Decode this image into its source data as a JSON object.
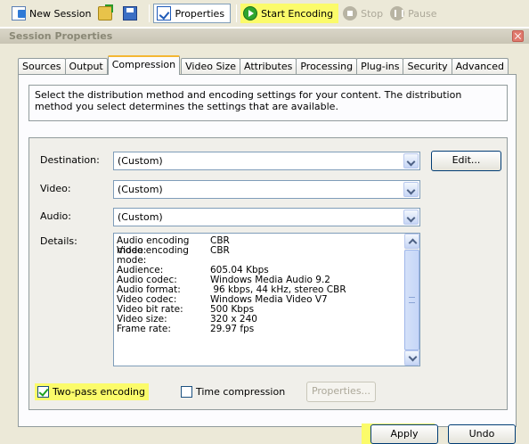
{
  "toolbar": {
    "new_session": "New Session",
    "properties": "Properties",
    "start_encoding": "Start Encoding",
    "stop": "Stop",
    "pause": "Pause"
  },
  "window": {
    "title": "Session Properties"
  },
  "tabs": [
    {
      "label": "Sources"
    },
    {
      "label": "Output"
    },
    {
      "label": "Compression",
      "active": true
    },
    {
      "label": "Video Size"
    },
    {
      "label": "Attributes"
    },
    {
      "label": "Processing"
    },
    {
      "label": "Plug-ins"
    },
    {
      "label": "Security"
    },
    {
      "label": "Advanced"
    }
  ],
  "intro_text": "Select the distribution method and encoding settings for your content. The distribution method you select determines the settings that are available.",
  "form": {
    "destination": {
      "label": "Destination:",
      "value": "(Custom)"
    },
    "video": {
      "label": "Video:",
      "value": "(Custom)"
    },
    "audio": {
      "label": "Audio:",
      "value": "(Custom)"
    },
    "edit_button": "Edit...",
    "details_label": "Details:"
  },
  "details": [
    {
      "k": "Audio encoding mode:",
      "v": "CBR"
    },
    {
      "k": "Video encoding mode:",
      "v": "CBR"
    },
    {
      "k": "",
      "v": ""
    },
    {
      "k": "Audience:",
      "v": "605.04 Kbps"
    },
    {
      "k": "Audio codec:",
      "v": "Windows Media Audio 9.2"
    },
    {
      "k": "Audio format:",
      "v": " 96 kbps, 44 kHz, stereo CBR"
    },
    {
      "k": "Video codec:",
      "v": "Windows Media Video V7"
    },
    {
      "k": "Video bit rate:",
      "v": "500 Kbps"
    },
    {
      "k": "Video size:",
      "v": "320 x 240"
    },
    {
      "k": "Frame rate:",
      "v": "29.97 fps"
    }
  ],
  "options": {
    "two_pass": {
      "label": "Two-pass encoding",
      "checked": true
    },
    "time_compression": {
      "label": "Time compression",
      "checked": false
    },
    "properties_button": "Properties..."
  },
  "buttons": {
    "apply": "Apply",
    "undo": "Undo"
  },
  "colors": {
    "highlight": "#fbfb6a",
    "tab_accent": "#f4b733",
    "dialog_bg": "#ece9d8"
  }
}
